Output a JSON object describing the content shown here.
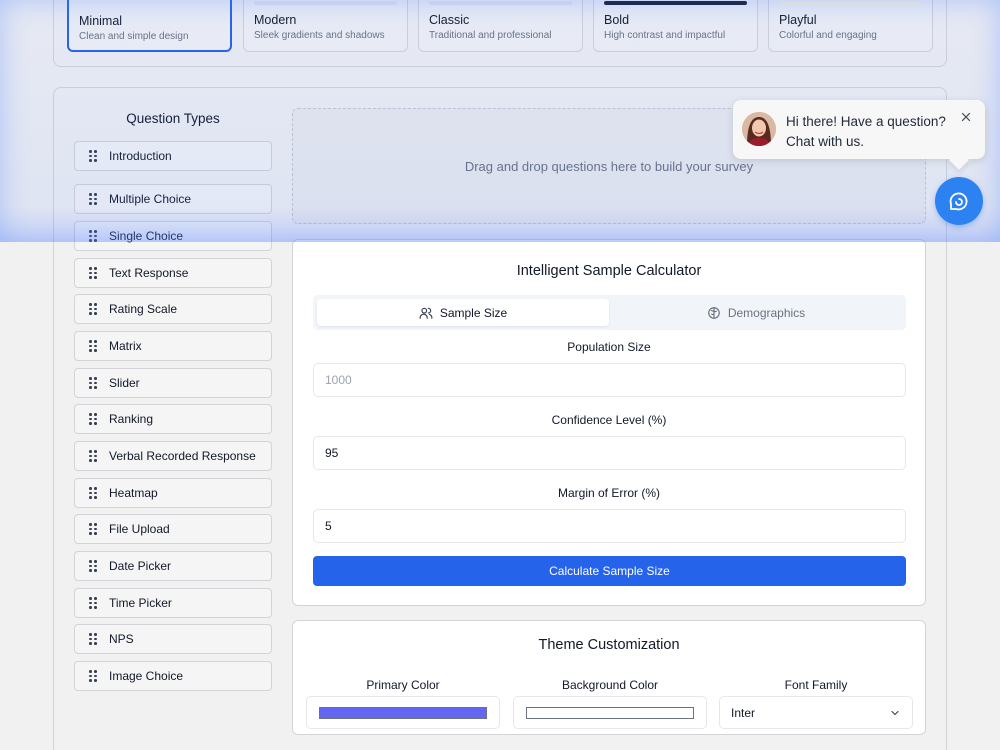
{
  "themes": [
    {
      "name": "Minimal",
      "desc": "Clean and simple design",
      "selected": true,
      "swatch": "#ffffff"
    },
    {
      "name": "Modern",
      "desc": "Sleek gradients and shadows",
      "selected": false,
      "swatch": "#e5e7eb"
    },
    {
      "name": "Classic",
      "desc": "Traditional and professional",
      "selected": false,
      "swatch": "#e5e7eb"
    },
    {
      "name": "Bold",
      "desc": "High contrast and impactful",
      "selected": false,
      "swatch": "#111827"
    },
    {
      "name": "Playful",
      "desc": "Colorful and engaging",
      "selected": false,
      "swatch": "#fdf6dc"
    }
  ],
  "question_types": {
    "title": "Question Types",
    "items": [
      "Introduction",
      "Multiple Choice",
      "Single Choice",
      "Text Response",
      "Rating Scale",
      "Matrix",
      "Slider",
      "Ranking",
      "Verbal Recorded Response",
      "Heatmap",
      "File Upload",
      "Date Picker",
      "Time Picker",
      "NPS",
      "Image Choice"
    ]
  },
  "dropzone": {
    "text": "Drag and drop questions here to build your survey"
  },
  "calculator": {
    "title": "Intelligent Sample Calculator",
    "tabs": {
      "sample_size": "Sample Size",
      "demographics": "Demographics"
    },
    "population_label": "Population Size",
    "population_placeholder": "1000",
    "confidence_label": "Confidence Level (%)",
    "confidence_value": "95",
    "margin_label": "Margin of Error (%)",
    "margin_value": "5",
    "button": "Calculate Sample Size"
  },
  "theme_customization": {
    "title": "Theme Customization",
    "primary_label": "Primary Color",
    "primary_color": "#6366f1",
    "background_label": "Background Color",
    "background_color": "#ffffff",
    "font_label": "Font Family",
    "font_value": "Inter"
  },
  "chat": {
    "message": "Hi there! Have a question? Chat with us.",
    "accent": "#2b82f0"
  }
}
